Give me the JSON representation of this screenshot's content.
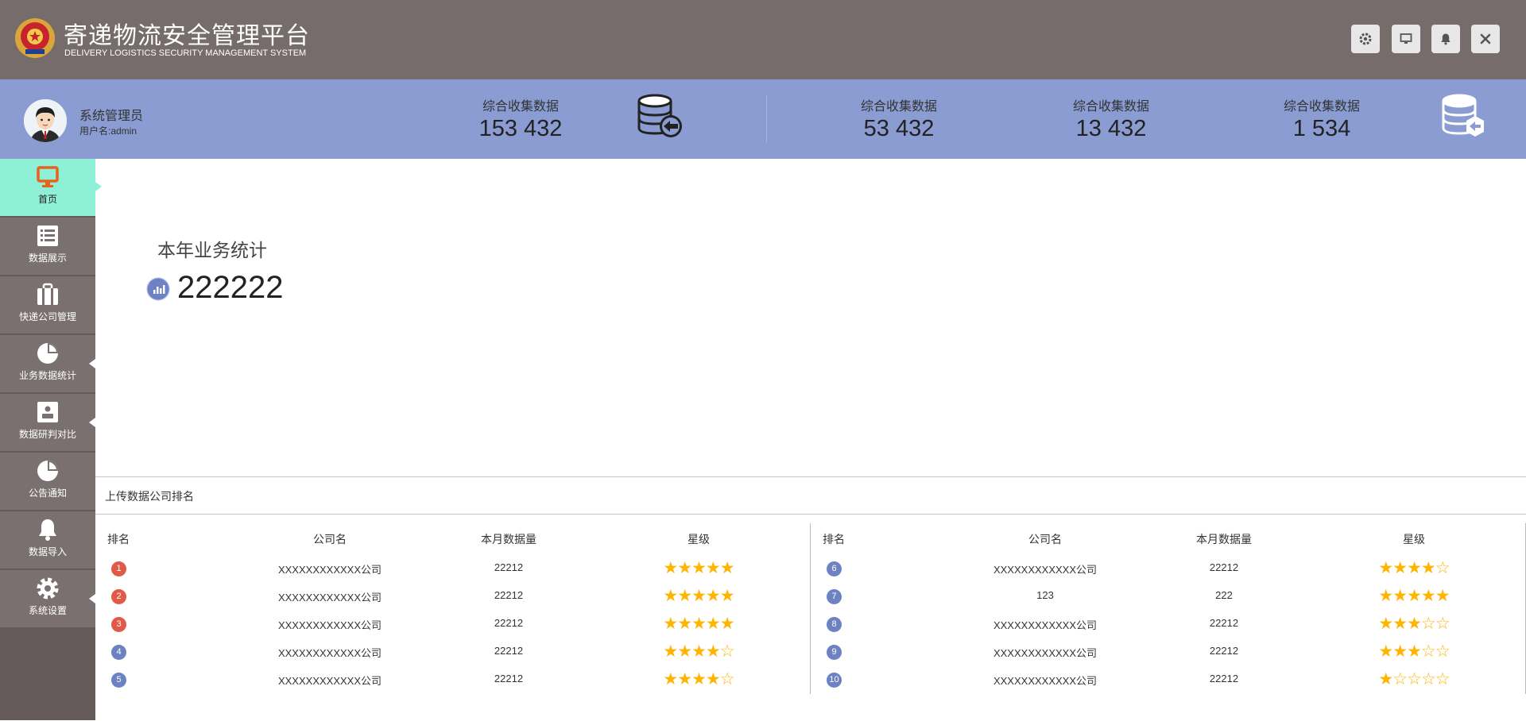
{
  "header": {
    "title": "寄递物流安全管理平台",
    "subtitle": "DELIVERY LOGISTICS SECURITY MANAGEMENT SYSTEM",
    "buttons": [
      "settings-icon",
      "monitor-icon",
      "bell-icon",
      "close-icon"
    ]
  },
  "user": {
    "role": "系统管理员",
    "username": "用户名:admin"
  },
  "stats": [
    {
      "label": "综合收集数据",
      "value": "153 432"
    },
    {
      "label": "综合收集数据",
      "value": "53 432"
    },
    {
      "label": "综合收集数据",
      "value": "13 432"
    },
    {
      "label": "综合收集数据",
      "value": "1 534"
    }
  ],
  "sidebar": {
    "items": [
      {
        "label": "首页",
        "icon": "monitor-icon",
        "active": true
      },
      {
        "label": "数据展示",
        "icon": "list-icon"
      },
      {
        "label": "快递公司管理",
        "icon": "briefcase-icon"
      },
      {
        "label": "业务数据统计",
        "icon": "pie-chart-icon"
      },
      {
        "label": "数据研判对比",
        "icon": "safe-icon"
      },
      {
        "label": "公告通知",
        "icon": "pie-chart-icon"
      },
      {
        "label": "数据导入",
        "icon": "bell-icon"
      },
      {
        "label": "系统设置",
        "icon": "gear-icon"
      }
    ]
  },
  "year_stats": {
    "title": "本年业务统计",
    "value": "222222"
  },
  "ranking": {
    "title": "上传数据公司排名",
    "headers": {
      "rank": "排名",
      "company": "公司名",
      "monthly": "本月数据量",
      "stars": "星级"
    },
    "rows": [
      {
        "rank": "1",
        "company": "XXXXXXXXXXXX公司",
        "monthly": "22212",
        "stars": 5
      },
      {
        "rank": "2",
        "company": "XXXXXXXXXXXX公司",
        "monthly": "22212",
        "stars": 5
      },
      {
        "rank": "3",
        "company": "XXXXXXXXXXXX公司",
        "monthly": "22212",
        "stars": 5
      },
      {
        "rank": "4",
        "company": "XXXXXXXXXXXX公司",
        "monthly": "22212",
        "stars": 4
      },
      {
        "rank": "5",
        "company": "XXXXXXXXXXXX公司",
        "monthly": "22212",
        "stars": 4
      },
      {
        "rank": "6",
        "company": "XXXXXXXXXXXX公司",
        "monthly": "22212",
        "stars": 4
      },
      {
        "rank": "7",
        "company": "123",
        "monthly": "222",
        "stars": 5
      },
      {
        "rank": "8",
        "company": "XXXXXXXXXXXX公司",
        "monthly": "22212",
        "stars": 3
      },
      {
        "rank": "9",
        "company": "XXXXXXXXXXXX公司",
        "monthly": "22212",
        "stars": 3
      },
      {
        "rank": "10",
        "company": "XXXXXXXXXXXX公司",
        "monthly": "22212",
        "stars": 1
      }
    ],
    "colors": {
      "top3": "#e05a47",
      "other": "#6d82c2",
      "star": "#ffb400"
    }
  }
}
